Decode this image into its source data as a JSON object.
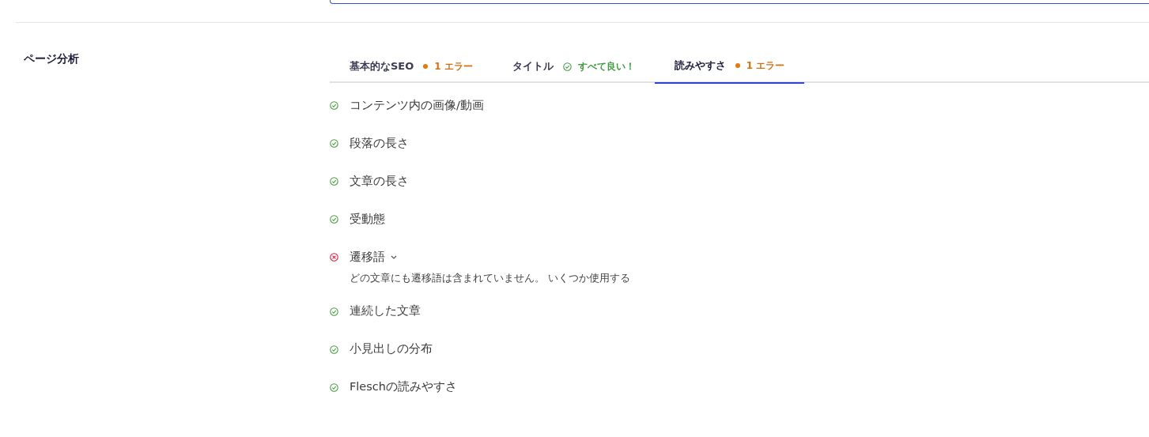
{
  "section_label": "ページ分析",
  "tabs": [
    {
      "label": "基本的なSEO",
      "selected": false,
      "status": {
        "kind": "error",
        "text": "1 エラー"
      }
    },
    {
      "label": "タイトル",
      "selected": false,
      "status": {
        "kind": "good",
        "text": "すべて良い！"
      }
    },
    {
      "label": "読みやすさ",
      "selected": true,
      "status": {
        "kind": "error",
        "text": "1 エラー"
      }
    }
  ],
  "checks": [
    {
      "label": "コンテンツ内の画像/動画",
      "kind": "pass",
      "expanded": false
    },
    {
      "label": "段落の長さ",
      "kind": "pass",
      "expanded": false
    },
    {
      "label": "文章の長さ",
      "kind": "pass",
      "expanded": false
    },
    {
      "label": "受動態",
      "kind": "pass",
      "expanded": false
    },
    {
      "label": "遷移語",
      "kind": "fail",
      "expanded": true,
      "description": "どの文章にも遷移語は含まれていません。 いくつか使用する"
    },
    {
      "label": "連続した文章",
      "kind": "pass",
      "expanded": false
    },
    {
      "label": "小見出しの分布",
      "kind": "pass",
      "expanded": false
    },
    {
      "label": "Fleschの読みやすさ",
      "kind": "pass",
      "expanded": false
    }
  ]
}
